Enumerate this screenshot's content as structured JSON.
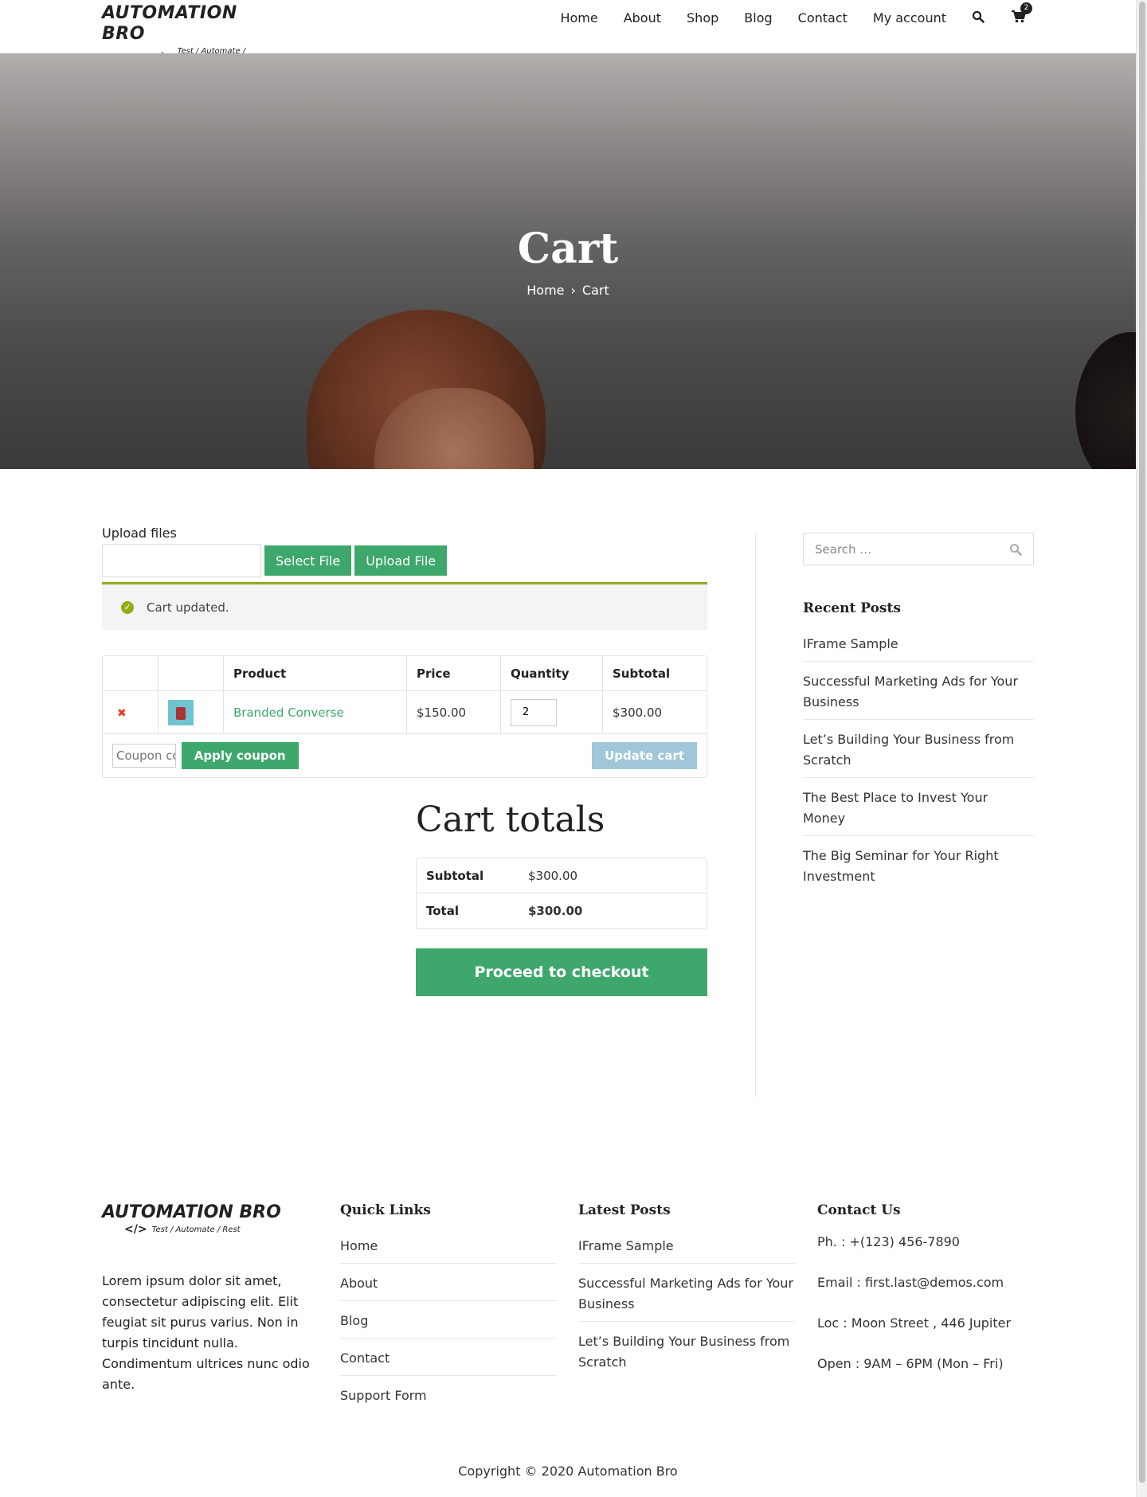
{
  "brand": {
    "name": "AUTOMATION BRO",
    "tagline": "Test / Automate / Rest",
    "code_glyph": "</>"
  },
  "nav": {
    "items": [
      "Home",
      "About",
      "Shop",
      "Blog",
      "Contact",
      "My account"
    ],
    "search_icon": "search-icon",
    "cart_icon": "shopping-cart-icon",
    "cart_count": "2"
  },
  "hero": {
    "title": "Cart",
    "breadcrumb": {
      "home": "Home",
      "separator": "›",
      "current": "Cart"
    }
  },
  "upload": {
    "label": "Upload files",
    "select_label": "Select File",
    "upload_label": "Upload File"
  },
  "notice": {
    "text": "Cart updated.",
    "icon": "check-circle-icon",
    "accent_color": "#8fae1b"
  },
  "cart_table": {
    "headers": {
      "remove": "",
      "thumbnail": "",
      "product": "Product",
      "price": "Price",
      "quantity": "Quantity",
      "subtotal": "Subtotal"
    },
    "rows": [
      {
        "remove": "✖",
        "product": "Branded Converse",
        "price": "$150.00",
        "quantity": "2",
        "subtotal": "$300.00"
      }
    ],
    "coupon_placeholder": "Coupon code",
    "apply_label": "Apply coupon",
    "update_label": "Update cart"
  },
  "totals": {
    "heading": "Cart totals",
    "subtotal_label": "Subtotal",
    "subtotal_value": "$300.00",
    "total_label": "Total",
    "total_value": "$300.00",
    "checkout_label": "Proceed to checkout"
  },
  "sidebar": {
    "search_placeholder": "Search …",
    "recent_heading": "Recent Posts",
    "recent_posts": [
      "IFrame Sample",
      "Successful Marketing Ads for Your Business",
      "Let’s Building Your Business from Scratch",
      "The Best Place to Invest Your Money",
      "The Big Seminar for Your Right Investment"
    ]
  },
  "footer": {
    "description": "Lorem ipsum dolor sit amet, consectetur adipiscing elit. Elit feugiat sit purus varius. Non in turpis tincidunt nulla. Condimentum ultrices nunc odio ante.",
    "quick_links_heading": "Quick Links",
    "quick_links": [
      "Home",
      "About",
      "Blog",
      "Contact",
      "Support Form"
    ],
    "latest_heading": "Latest Posts",
    "latest_posts": [
      "IFrame Sample",
      "Successful Marketing Ads for Your Business",
      "Let’s Building Your Business from Scratch"
    ],
    "contact_heading": "Contact Us",
    "contact": {
      "phone": "Ph. : +(123) 456-7890",
      "email": "Email : first.last@demos.com",
      "location": "Loc : Moon Street , 446 Jupiter",
      "hours": "Open : 9AM – 6PM (Mon – Fri)"
    },
    "copyright": "Copyright © 2020 Automation Bro"
  },
  "colors": {
    "accent_green": "#3ea86c",
    "update_button": "#9fc7d8",
    "remove_red": "#e2401c"
  }
}
